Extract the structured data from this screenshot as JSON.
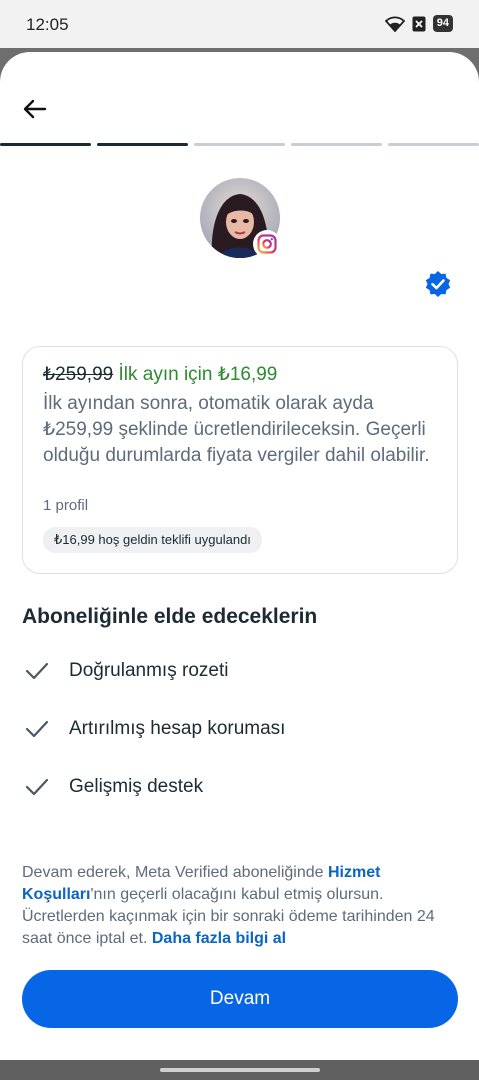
{
  "status_bar": {
    "time": "12:05",
    "battery": "94",
    "icons": [
      "wifi-icon",
      "no-sim-icon",
      "battery-icon"
    ]
  },
  "progress": {
    "total_steps": 5,
    "completed_steps": 2,
    "active_color": "#1c2b33",
    "inactive_color": "#c9ced4"
  },
  "profile": {
    "avatar": "profile-photo",
    "platform_badge": "instagram-icon",
    "verified_badge": "verified-badge-icon",
    "verified_color": "#0766e5"
  },
  "offer": {
    "old_price": "₺259,99",
    "promo_text": "İlk ayın için ₺16,99",
    "description": "İlk ayından sonra, otomatik olarak ayda ₺259,99 şeklinde ücretlendirileceksin. Geçerli olduğu durumlarda fiyata vergiler dahil olabilir.",
    "profile_count": "1 profil",
    "welcome_chip": "₺16,99 hoş geldin teklifi uygulandı"
  },
  "benefits": {
    "title": "Aboneliğinle elde edeceklerin",
    "items": [
      {
        "label": "Doğrulanmış rozeti"
      },
      {
        "label": "Artırılmış hesap koruması"
      },
      {
        "label": "Gelişmiş destek"
      }
    ]
  },
  "legal": {
    "text_1": "Devam ederek, Meta Verified aboneliğinde ",
    "link_terms": "Hizmet Koşulları",
    "text_2": "'nın geçerli olacağını kabul etmiş olursun. Ücretlerden kaçınmak için bir sonraki ödeme tarihinden 24 saat önce iptal et. ",
    "link_more": "Daha fazla bilgi al"
  },
  "actions": {
    "continue_label": "Devam",
    "primary_color": "#0766e5"
  }
}
